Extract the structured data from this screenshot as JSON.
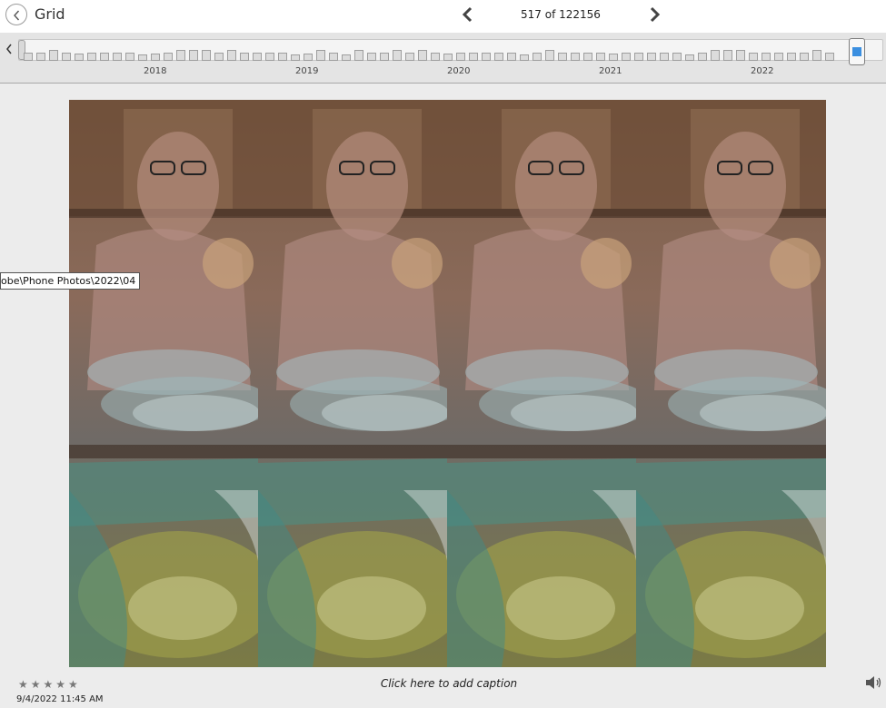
{
  "header": {
    "back_label": "Grid",
    "counter": "517 of 122156"
  },
  "timeline": {
    "years": [
      "2018",
      "2019",
      "2020",
      "2021",
      "2022"
    ]
  },
  "photo": {
    "folder_tooltip": "obe\\Phone Photos\\2022\\04"
  },
  "footer": {
    "rating_stars": "★★★★★",
    "date": "9/4/2022 11:45 AM",
    "caption_placeholder": "Click here to add caption"
  },
  "colors": {
    "header_bg": "#ffffff",
    "timeline_bg": "#e4e4e4",
    "thumb_accent": "#3b8fe0",
    "page_bg": "#ececec"
  },
  "icons": {
    "back": "chevron-left-icon",
    "prev": "chevron-left-icon",
    "next": "chevron-right-icon",
    "speaker": "speaker-icon"
  }
}
